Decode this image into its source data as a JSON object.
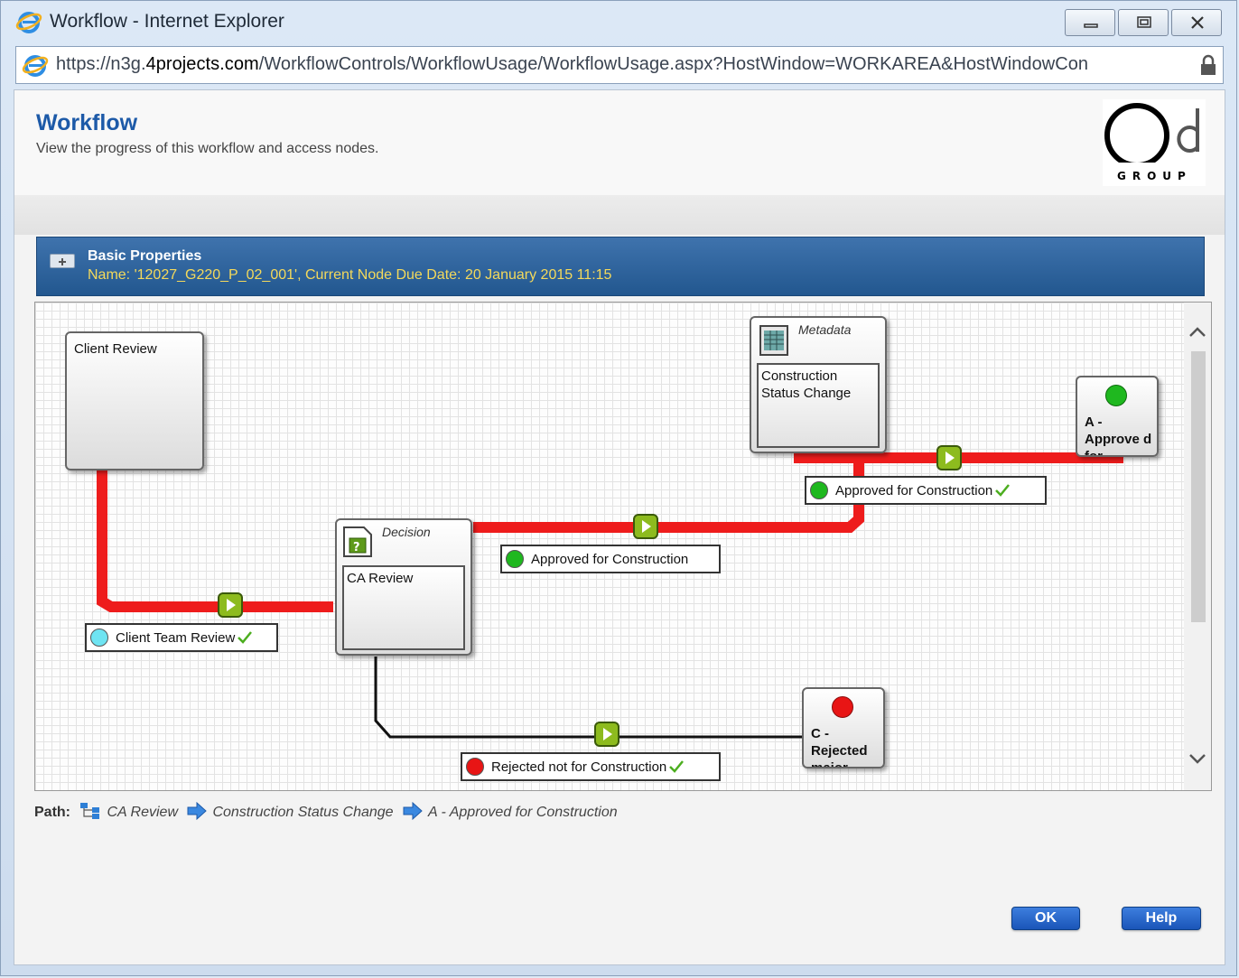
{
  "window": {
    "title": "Workflow - Internet Explorer",
    "url_prefix": "https://n3g.",
    "url_domain": "4projects.com",
    "url_path": "/WorkflowControls/WorkflowUsage/WorkflowUsage.aspx?HostWindow=WORKAREA&HostWindowCon"
  },
  "header": {
    "title": "Workflow",
    "subtitle": "View the progress of this workflow and access nodes.",
    "logo_text": "GROUP"
  },
  "properties": {
    "title": "Basic Properties",
    "details": "Name: '12027_G220_P_02_001', Current Node Due Date: 20 January 2015 11:15"
  },
  "workflow": {
    "nodes": {
      "client_review": {
        "title": "Client Review"
      },
      "ca_review": {
        "type": "Decision",
        "title": "CA Review"
      },
      "metadata": {
        "type": "Metadata",
        "title": "Construction Status Change"
      },
      "approved_end": {
        "title": "A - Approve d for",
        "status_color": "#1fb81f"
      },
      "rejected_end": {
        "title": "C - Rejected major",
        "status_color": "#e81515"
      }
    },
    "transitions": {
      "client_team_review": {
        "label": "Client Team Review",
        "color": "#6fe4f2",
        "done": true
      },
      "approved_from_ca": {
        "label": "Approved for Construction",
        "color": "#1fb81f",
        "done": false
      },
      "approved_from_meta": {
        "label": "Approved for Construction",
        "color": "#1fb81f",
        "done": true
      },
      "rejected": {
        "label": "Rejected not for Construction",
        "color": "#e81515",
        "done": true
      }
    },
    "colors": {
      "active_path": "#ee1c1c",
      "inactive_path": "#111111",
      "play_button": "#8dbb1e"
    }
  },
  "path": {
    "label": "Path:",
    "steps": [
      "CA Review",
      "Construction Status Change",
      "A - Approved for Construction"
    ]
  },
  "buttons": {
    "ok": "OK",
    "help": "Help"
  }
}
